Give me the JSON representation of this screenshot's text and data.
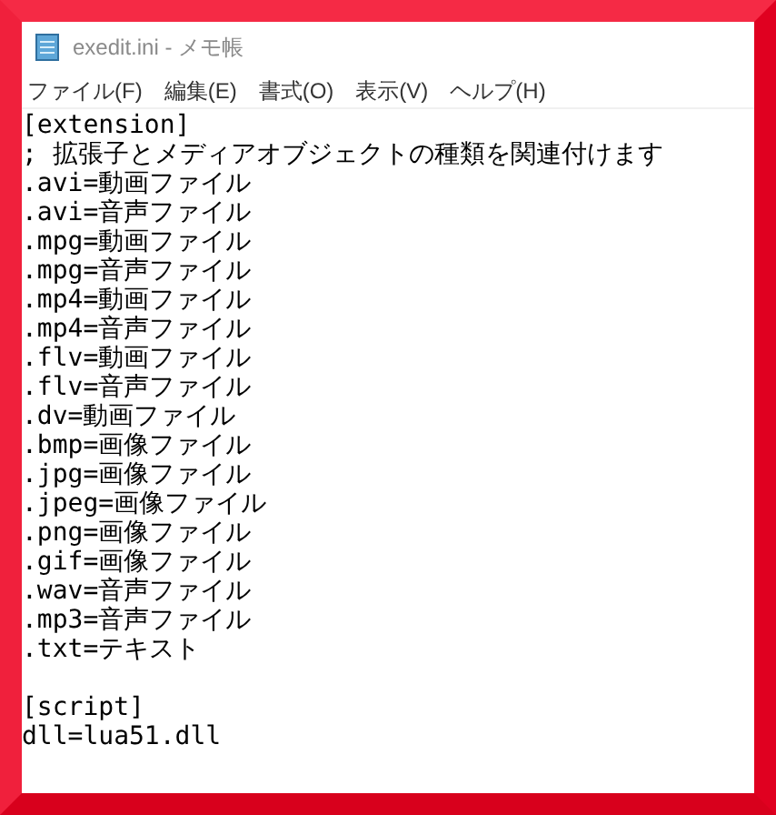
{
  "window": {
    "title": "exedit.ini - メモ帳"
  },
  "menu": [
    "ファイル(F)",
    "編集(E)",
    "書式(O)",
    "表示(V)",
    "ヘルプ(H)"
  ],
  "sections": [
    {
      "lines": [
        "[extension]",
        "; 拡張子とメディアオブジェクトの種類を関連付けます",
        ".avi=動画ファイル",
        ".avi=音声ファイル",
        ".mpg=動画ファイル",
        ".mpg=音声ファイル",
        ".mp4=動画ファイル",
        ".mp4=音声ファイル",
        ".flv=動画ファイル",
        ".flv=音声ファイル",
        ".dv=動画ファイル",
        ".bmp=画像ファイル",
        ".jpg=画像ファイル",
        ".jpeg=画像ファイル",
        ".png=画像ファイル",
        ".gif=画像ファイル",
        ".wav=音声ファイル",
        ".mp3=音声ファイル",
        ".txt=テキスト"
      ]
    },
    {
      "lines": [
        "[script]",
        "dll=lua51.dll"
      ]
    }
  ]
}
